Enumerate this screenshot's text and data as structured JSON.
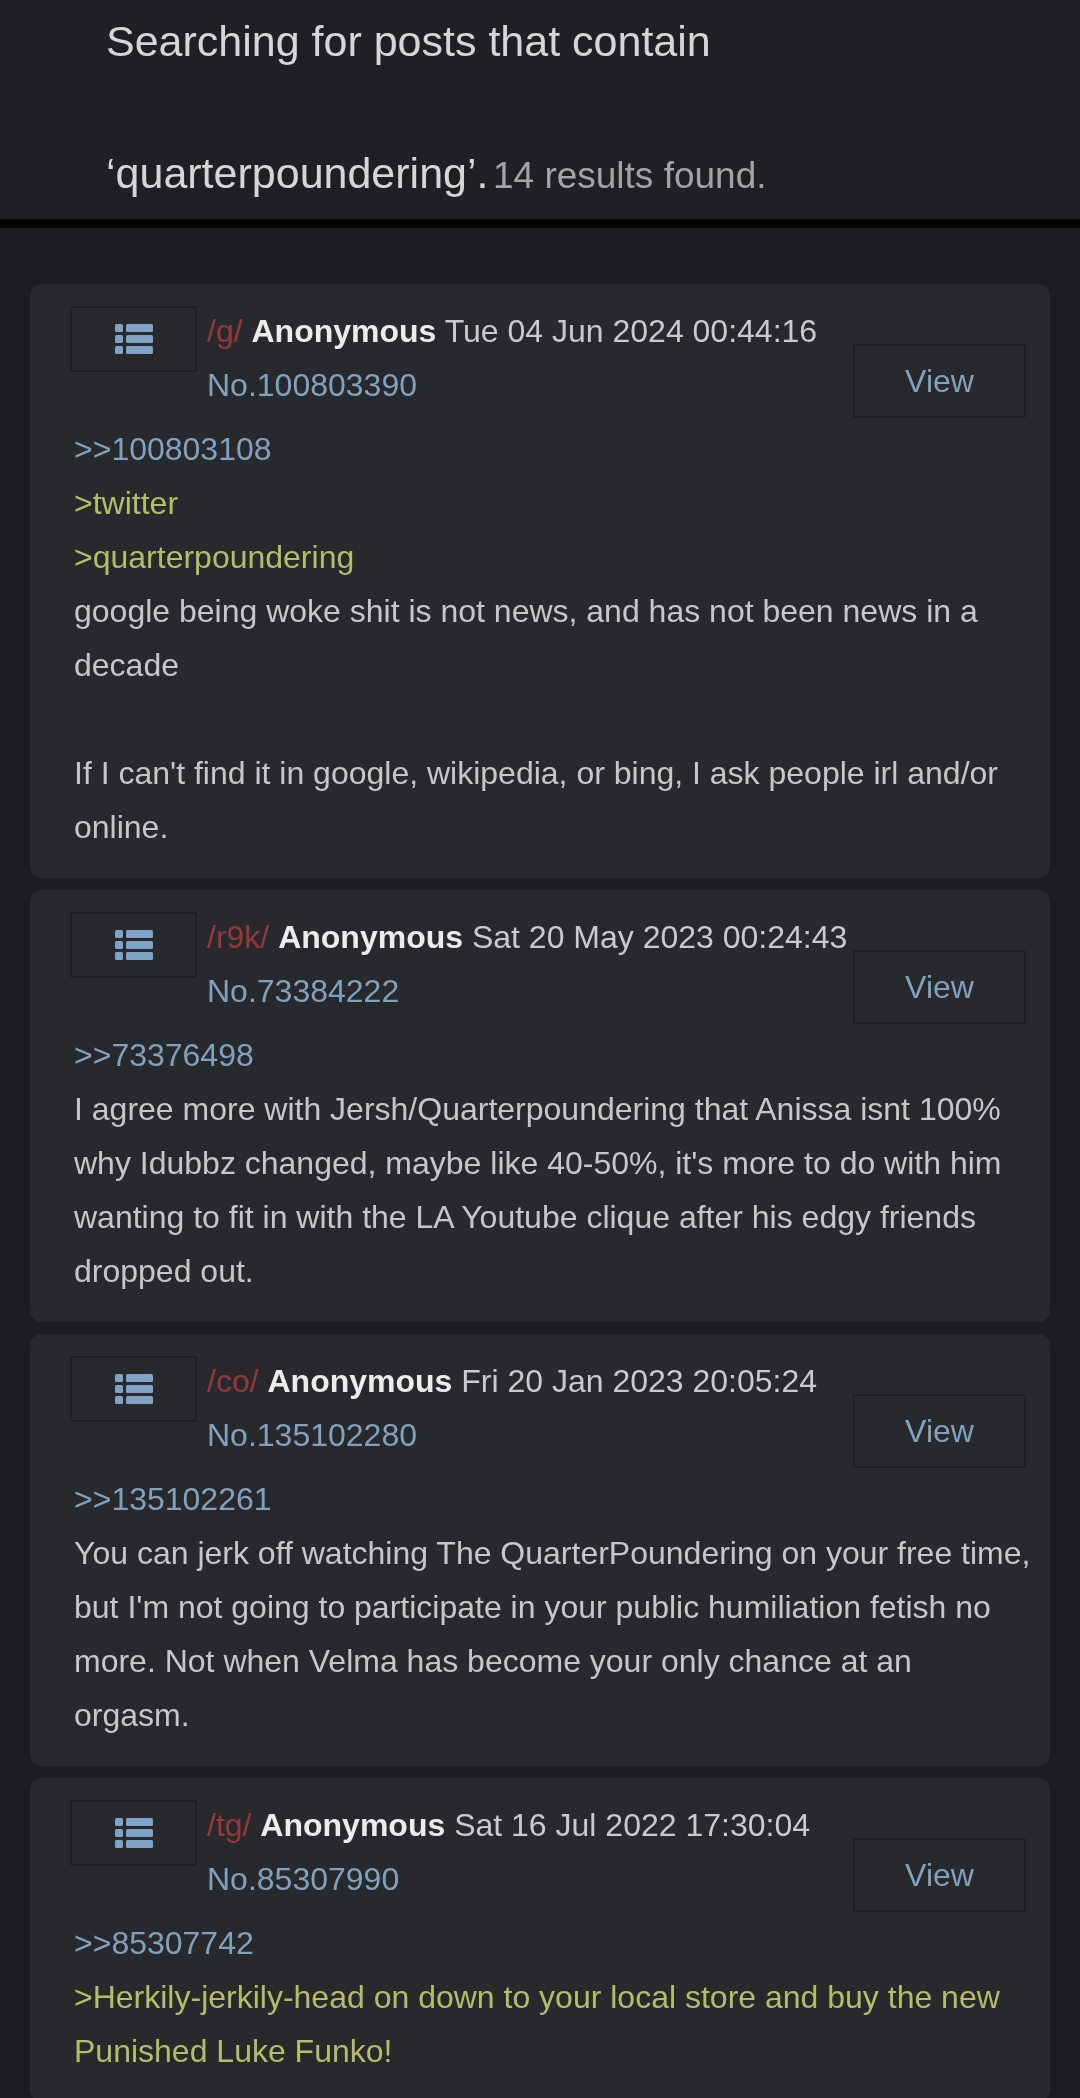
{
  "search_header": {
    "query_text": "Searching for posts that contain ‘quarterpoundering’.",
    "result_count": "14 results found."
  },
  "posts": [
    {
      "board": "/g/",
      "name": "Anonymous",
      "date": "Tue 04 Jun 2024 00:44:16",
      "number": "No.100803390",
      "view_label": "View",
      "body": [
        {
          "kind": "quotelink",
          "text": ">>100803108"
        },
        {
          "kind": "greentext",
          "text": ">twitter"
        },
        {
          "kind": "greentext",
          "text": ">quarterpoundering"
        },
        {
          "kind": "text",
          "text": "google being woke shit is not news, and has not been news in a decade\n\nIf I can't find it in google, wikipedia, or bing, I ask people irl and/or online."
        }
      ]
    },
    {
      "board": "/r9k/",
      "name": "Anonymous",
      "date": "Sat 20 May 2023 00:24:43",
      "number": "No.73384222",
      "view_label": "View",
      "body": [
        {
          "kind": "quotelink",
          "text": ">>73376498"
        },
        {
          "kind": "text",
          "text": "I agree more with Jersh/Quarterpoundering that Anissa isnt 100% why Idubbz changed, maybe like 40-50%, it's more to do with him wanting to fit in with the LA Youtube clique after his edgy friends dropped out."
        }
      ]
    },
    {
      "board": "/co/",
      "name": "Anonymous",
      "date": "Fri 20 Jan 2023 20:05:24",
      "number": "No.135102280",
      "view_label": "View",
      "body": [
        {
          "kind": "quotelink",
          "text": ">>135102261"
        },
        {
          "kind": "text",
          "text": "You can jerk off watching The QuarterPoundering on your free time, but I'm not going to participate in your public humiliation fetish no more. Not when Velma has become your only chance at an orgasm."
        }
      ]
    },
    {
      "board": "/tg/",
      "name": "Anonymous",
      "date": "Sat 16 Jul 2022 17:30:04",
      "number": "No.85307990",
      "view_label": "View",
      "body": [
        {
          "kind": "quotelink",
          "text": ">>85307742"
        },
        {
          "kind": "greentext",
          "text": ">Herkily-jerkily-head on down to your local store and buy the new Punished Luke Funko!"
        }
      ]
    }
  ]
}
